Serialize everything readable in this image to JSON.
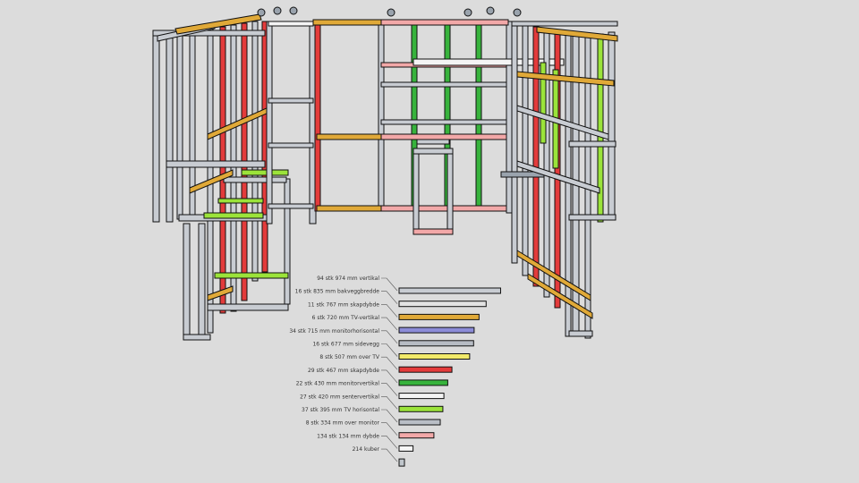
{
  "scene": {
    "background": "#dcdcdc",
    "frame_color": "#9aa3ad",
    "edge_color": "#111111"
  },
  "legend": [
    {
      "label": "94 stk 974 mm vertikal",
      "color": "#c8ccd2"
    },
    {
      "label": "16 stk 835 mm bakveggbredde",
      "color": "#e3e3e3"
    },
    {
      "label": "11 stk 767 mm skapdybde",
      "color": "#e0a938"
    },
    {
      "label": "6 stk 720 mm TV-vertikal",
      "color": "#8c8cd8"
    },
    {
      "label": "34 stk 715 mm monitorhorisontal",
      "color": "#b7bcc4"
    },
    {
      "label": "16 stk 677 mm sidevegg",
      "color": "#f2ea6a"
    },
    {
      "label": "8 stk 507 mm over TV",
      "color": "#e33b3b"
    },
    {
      "label": "29 stk 467 mm skapdybde",
      "color": "#37b33c"
    },
    {
      "label": "22 stk 430 mm monitorvertikal",
      "color": "#f4f4f4"
    },
    {
      "label": "27 stk 420 mm senter­vertikal",
      "color": "#9be33a"
    },
    {
      "label": "37 stk 395 mm TV horisontal",
      "color": "#b9bec6"
    },
    {
      "label": "8 stk 334 mm over monitor",
      "color": "#f2a8a8"
    },
    {
      "label": "134 stk 134 mm dybde",
      "color": "#f7f7f7"
    },
    {
      "label": "214 kuber",
      "color": "#c0c6cc"
    }
  ]
}
